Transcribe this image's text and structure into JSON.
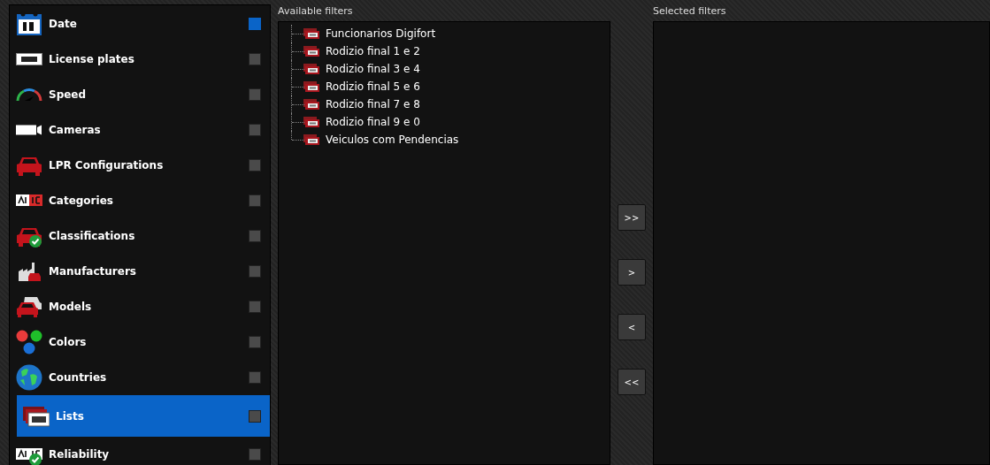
{
  "filter_types": [
    {
      "label": "Date",
      "checked": true,
      "selected": false
    },
    {
      "label": "License plates",
      "checked": false,
      "selected": false
    },
    {
      "label": "Speed",
      "checked": false,
      "selected": false
    },
    {
      "label": "Cameras",
      "checked": false,
      "selected": false
    },
    {
      "label": "LPR Configurations",
      "checked": false,
      "selected": false
    },
    {
      "label": "Categories",
      "checked": false,
      "selected": false
    },
    {
      "label": "Classifications",
      "checked": false,
      "selected": false
    },
    {
      "label": "Manufacturers",
      "checked": false,
      "selected": false
    },
    {
      "label": "Models",
      "checked": false,
      "selected": false
    },
    {
      "label": "Colors",
      "checked": false,
      "selected": false
    },
    {
      "label": "Countries",
      "checked": false,
      "selected": false
    },
    {
      "label": "Lists",
      "checked": false,
      "selected": true
    },
    {
      "label": "Reliability",
      "checked": false,
      "selected": false
    }
  ],
  "available_filters": {
    "title": "Available filters",
    "items": [
      {
        "label": "Funcionarios Digifort"
      },
      {
        "label": "Rodizio final 1 e 2"
      },
      {
        "label": "Rodizio final 3 e 4"
      },
      {
        "label": "Rodizio final 5 e 6"
      },
      {
        "label": "Rodizio final 7 e 8"
      },
      {
        "label": "Rodizio final 9 e 0"
      },
      {
        "label": "Veiculos com Pendencias"
      }
    ]
  },
  "move_buttons": [
    ">>",
    ">",
    "<",
    "<<"
  ],
  "selected_filters": {
    "title": "Selected filters"
  }
}
